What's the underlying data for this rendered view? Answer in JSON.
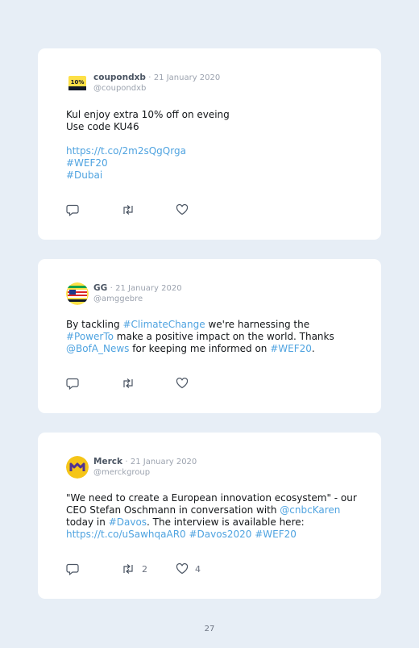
{
  "tweets": [
    {
      "name": "coupondxb",
      "date": "21 January 2020",
      "handle": "@coupondxb",
      "avatar_text": "10%",
      "lines": [
        [
          {
            "t": "Kul enjoy extra 10% off on eveing",
            "link": false
          }
        ],
        [
          {
            "t": "Use code KU46",
            "link": false
          }
        ],
        [],
        [
          {
            "t": "https://t.co/2m2sQgQrga",
            "link": true
          }
        ],
        [
          {
            "t": "#WEF20",
            "link": true
          }
        ],
        [
          {
            "t": "#Dubai",
            "link": true
          }
        ]
      ],
      "retweets": "",
      "likes": ""
    },
    {
      "name": "GG",
      "date": "21 January 2020",
      "handle": "@amggebre",
      "lines": [
        [
          {
            "t": "By tackling ",
            "link": false
          },
          {
            "t": "#ClimateChange",
            "link": true
          },
          {
            "t": " we're harnessing the",
            "link": false
          }
        ],
        [
          {
            "t": "#PowerTo",
            "link": true
          },
          {
            "t": " make a positive impact on the world. Thanks",
            "link": false
          }
        ],
        [
          {
            "t": "@BofA_News",
            "link": true
          },
          {
            "t": " for keeping me informed on ",
            "link": false
          },
          {
            "t": "#WEF20",
            "link": true
          },
          {
            "t": ".",
            "link": false
          }
        ]
      ],
      "retweets": "",
      "likes": ""
    },
    {
      "name": "Merck",
      "date": "21 January 2020",
      "handle": "@merckgroup",
      "avatar_text": "M",
      "lines": [
        [
          {
            "t": "\"We need to create a European innovation ecosystem\" - our",
            "link": false
          }
        ],
        [
          {
            "t": "CEO Stefan Oschmann in conversation with ",
            "link": false
          },
          {
            "t": "@cnbcKaren",
            "link": true
          }
        ],
        [
          {
            "t": "today in ",
            "link": false
          },
          {
            "t": "#Davos",
            "link": true
          },
          {
            "t": ". The interview is available here:",
            "link": false
          }
        ],
        [
          {
            "t": "https://t.co/uSawhqaAR0",
            "link": true
          },
          {
            "t": " ",
            "link": false
          },
          {
            "t": "#Davos2020",
            "link": true
          },
          {
            "t": " ",
            "link": false
          },
          {
            "t": "#WEF20",
            "link": true
          }
        ]
      ],
      "retweets": "2",
      "likes": "4"
    }
  ],
  "separator": "·",
  "page_number": "27",
  "colors": {
    "background": "#e7eef6",
    "card": "#ffffff",
    "link": "#4fa3e0",
    "muted": "#9ca3af",
    "merck_yellow": "#f5c518",
    "merck_purple": "#503291"
  },
  "icons": [
    "reply-icon",
    "retweet-icon",
    "like-icon"
  ]
}
